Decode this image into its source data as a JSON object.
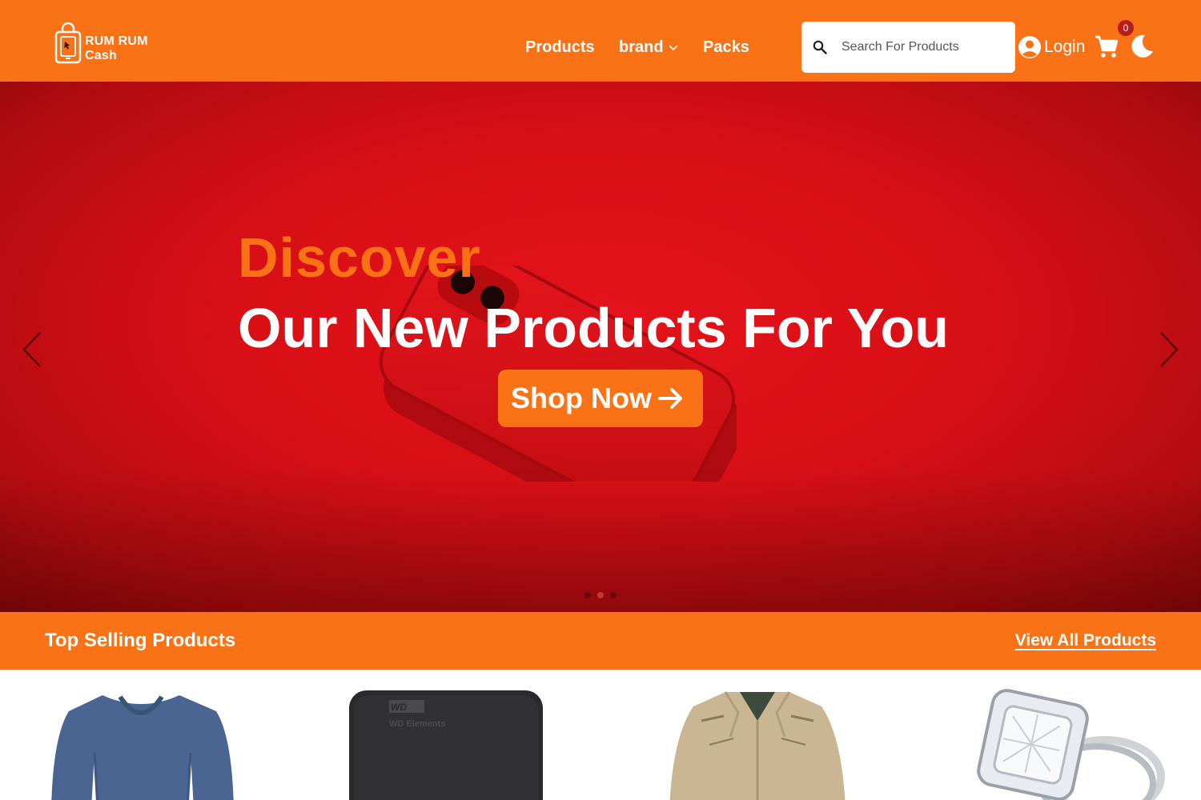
{
  "colors": {
    "brand": "#f97316",
    "hero_red": "#e5121a",
    "badge": "#b91c1c",
    "white": "#ffffff"
  },
  "header": {
    "logo": {
      "line1": "RUM RUM",
      "line2": "Cash",
      "icon": "shopping-bag-icon"
    },
    "nav": [
      {
        "label": "Products"
      },
      {
        "label": "brand",
        "icon": "chevron-down-icon"
      },
      {
        "label": "Packs"
      }
    ],
    "search": {
      "placeholder": "Search For Products",
      "value": "",
      "icon": "search-icon"
    },
    "login": {
      "label": "Login",
      "icon": "user-circle-icon"
    },
    "cart": {
      "count": "0",
      "icon": "cart-icon"
    },
    "theme_toggle": {
      "icon": "moon-icon"
    }
  },
  "hero": {
    "kicker": "Discover",
    "title": "Our New Products For You",
    "cta": "Shop Now",
    "cta_icon": "arrow-right-icon",
    "prev_icon": "chevron-left-icon",
    "next_icon": "chevron-right-icon",
    "slides": 3,
    "active_slide": 2
  },
  "top_selling": {
    "title": "Top Selling Products",
    "view_all": "View All Products",
    "items": [
      {
        "image": "blue-long-sleeve-shirt"
      },
      {
        "image": "external-hard-drive"
      },
      {
        "image": "beige-jacket"
      },
      {
        "image": "diamond-ring"
      }
    ]
  }
}
